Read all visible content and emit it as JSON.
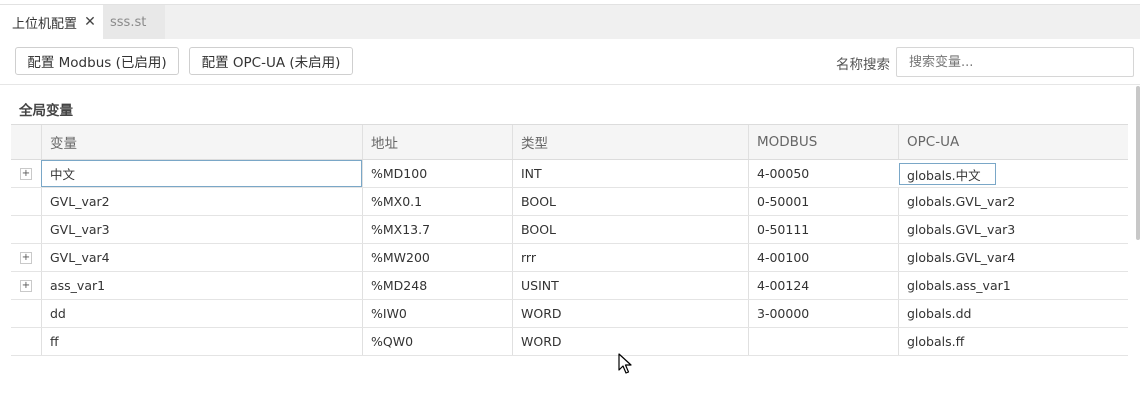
{
  "tabs": [
    {
      "label": "上位机配置",
      "active": true
    },
    {
      "label": "sss.st",
      "active": false
    }
  ],
  "toolbar": {
    "modbus_label": "配置 Modbus (已启用)",
    "opcua_label": "配置 OPC-UA (未启用)",
    "search_label": "名称搜索",
    "search_placeholder": "搜索变量...",
    "search_value": ""
  },
  "section_title": "全局变量",
  "table": {
    "headers": [
      "变量",
      "地址",
      "类型",
      "MODBUS",
      "OPC-UA"
    ],
    "rows": [
      {
        "expandable": true,
        "name": "中文",
        "address": "%MD100",
        "type": "INT",
        "modbus": "4-00050",
        "opcua": "globals.中文"
      },
      {
        "expandable": false,
        "name": "GVL_var2",
        "address": "%MX0.1",
        "type": "BOOL",
        "modbus": "0-50001",
        "opcua": "globals.GVL_var2"
      },
      {
        "expandable": false,
        "name": "GVL_var3",
        "address": "%MX13.7",
        "type": "BOOL",
        "modbus": "0-50111",
        "opcua": "globals.GVL_var3"
      },
      {
        "expandable": true,
        "name": "GVL_var4",
        "address": "%MW200",
        "type": "rrr",
        "modbus": "4-00100",
        "opcua": "globals.GVL_var4"
      },
      {
        "expandable": true,
        "name": "ass_var1",
        "address": "%MD248",
        "type": "USINT",
        "modbus": "4-00124",
        "opcua": "globals.ass_var1"
      },
      {
        "expandable": false,
        "name": "dd",
        "address": "%IW0",
        "type": "WORD",
        "modbus": "3-00000",
        "opcua": "globals.dd"
      },
      {
        "expandable": false,
        "name": "ff",
        "address": "%QW0",
        "type": "WORD",
        "modbus": "",
        "opcua": "globals.ff"
      }
    ]
  },
  "icons": {
    "tab_close": "close-icon",
    "expander": "plus-icon",
    "cursor": "mouse-pointer-icon"
  }
}
